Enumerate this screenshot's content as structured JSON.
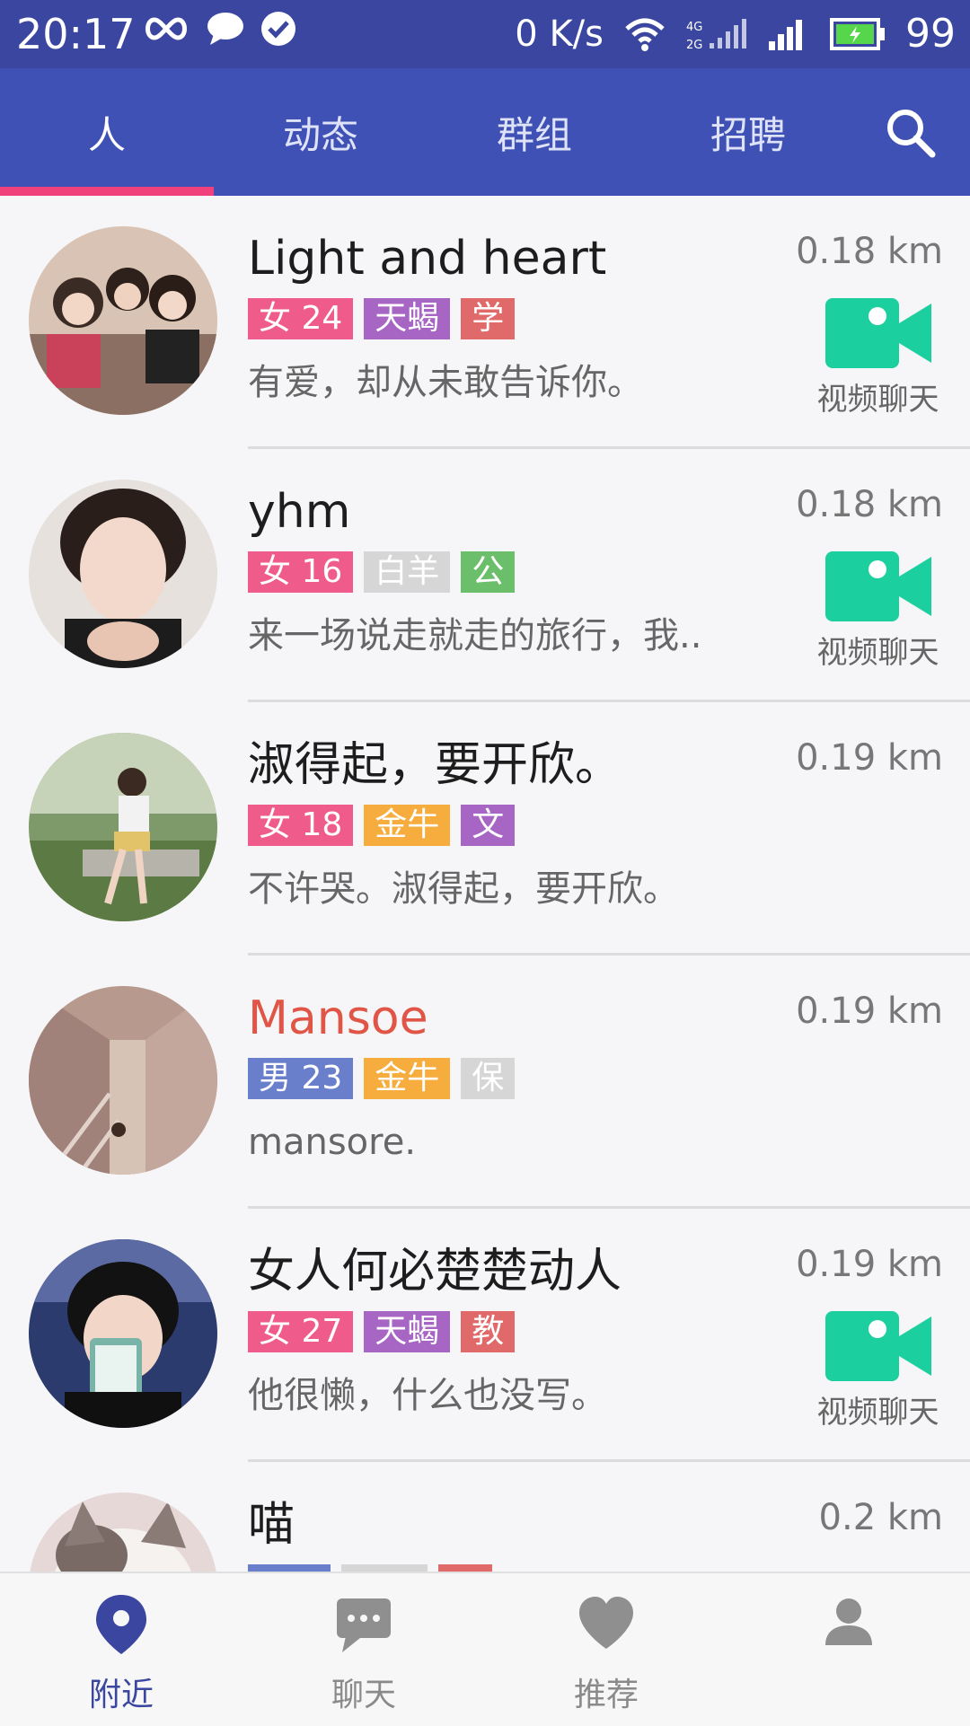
{
  "status_bar": {
    "time": "20:17",
    "speed": "0 K/s",
    "network": "4G 2G",
    "battery": "99"
  },
  "tabs": [
    {
      "label": "人",
      "active": true
    },
    {
      "label": "动态",
      "active": false
    },
    {
      "label": "群组",
      "active": false
    },
    {
      "label": "招聘",
      "active": false
    }
  ],
  "search_icon": "search-icon",
  "colors": {
    "primary": "#3f51b5",
    "indicator": "#f0417c",
    "video": "#1ccf9e",
    "female": "#ef5c8b",
    "male": "#6a7fcc",
    "scorpio": "#a866c4",
    "taurus": "#f6ad3d",
    "aries": "#d6d6d6",
    "red_tag": "#e06a6a",
    "green_tag": "#6bbf6b",
    "purple_tag": "#a866c4",
    "gray_tag": "#d6d6d6"
  },
  "users": [
    {
      "name": "Light and heart",
      "gender_age": "女 24",
      "gender": "female",
      "tag2": "天蝎",
      "tag2_color": "#a866c4",
      "tag3": "学",
      "tag3_color": "#e06a6a",
      "bio": "有爱，却从未敢告诉你。",
      "distance": "0.18 km",
      "video_chat": true,
      "video_label": "视频聊天"
    },
    {
      "name": "yhm",
      "gender_age": "女 16",
      "gender": "female",
      "tag2": "白羊",
      "tag2_color": "#d6d6d6",
      "tag3": "公",
      "tag3_color": "#6bbf6b",
      "bio": "来一场说走就走的旅行，我..",
      "distance": "0.18 km",
      "video_chat": true,
      "video_label": "视频聊天"
    },
    {
      "name": "淑得起，要开欣。",
      "gender_age": "女 18",
      "gender": "female",
      "tag2": "金牛",
      "tag2_color": "#f6ad3d",
      "tag3": "文",
      "tag3_color": "#a866c4",
      "bio": "不许哭。淑得起，要开欣。",
      "distance": "0.19 km",
      "video_chat": false
    },
    {
      "name": "Mansoe",
      "name_red": true,
      "gender_age": "男 23",
      "gender": "male",
      "tag2": "金牛",
      "tag2_color": "#f6ad3d",
      "tag3": "保",
      "tag3_color": "#d6d6d6",
      "bio": "mansore.",
      "distance": "0.19 km",
      "video_chat": false
    },
    {
      "name": "女人何必楚楚动人",
      "gender_age": "女 27",
      "gender": "female",
      "tag2": "天蝎",
      "tag2_color": "#a866c4",
      "tag3": "教",
      "tag3_color": "#e06a6a",
      "bio": "他很懒，什么也没写。",
      "distance": "0.19 km",
      "video_chat": true,
      "video_label": "视频聊天"
    },
    {
      "name": "喵",
      "distance": "0.2 km"
    }
  ],
  "bottom_nav": [
    {
      "label": "附近",
      "icon": "location-pin-icon",
      "active": true
    },
    {
      "label": "聊天",
      "icon": "chat-bubble-icon",
      "active": false
    },
    {
      "label": "推荐",
      "icon": "heart-icon",
      "active": false
    },
    {
      "label": "",
      "icon": "person-icon",
      "active": false
    }
  ]
}
